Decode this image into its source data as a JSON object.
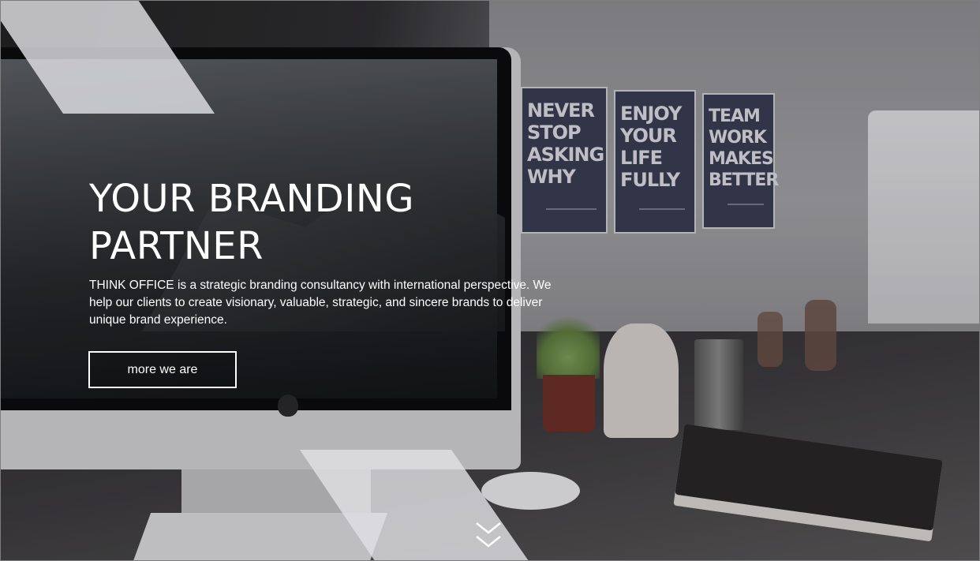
{
  "hero": {
    "headline": "YOUR BRANDING\nPARTNER",
    "description": "THINK OFFICE is a strategic branding consultancy with international perspective. We help our clients to create visionary, valuable, strategic, and sincere brands to deliver unique brand experience.",
    "cta_label": "more we are",
    "scroll_icon": "double-chevron-down-icon"
  },
  "background": {
    "posters": [
      {
        "text": "NEVER\nSTOP\nASKING\nWHY"
      },
      {
        "text": "ENJOY\nYOUR\nLIFE\nFULLY"
      },
      {
        "text": "TEAM\nWORK\nMAKES\nBETTER"
      }
    ]
  },
  "colors": {
    "text": "#ffffff",
    "accent_shape": "#e1e1e4",
    "poster": "#3a3d52"
  }
}
